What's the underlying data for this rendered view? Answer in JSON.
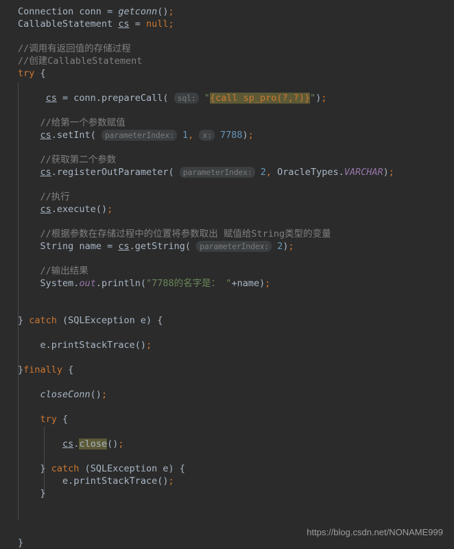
{
  "editor": {
    "theme": "darcula",
    "background": "#2B2B2B",
    "default_text_color": "#A9B7C6",
    "keyword_color": "#CC7832",
    "comment_color": "#808080",
    "number_color": "#6897BB",
    "string_color": "#6A8759",
    "static_field_color": "#9876AA",
    "hint_background": "#3B3F41",
    "hint_text_color": "#7A7A7A",
    "highlight_background": "#5C5A36",
    "indent_guide_color": "#4B4B4B"
  },
  "code": {
    "language": "Java",
    "lines": [
      "Connection conn = getconn();",
      "CallableStatement cs = null;",
      "",
      "//调用有返回值的存储过程",
      "//创建CallableStatement",
      "try {",
      "",
      "    cs = conn.prepareCall( sql: \"{call sp_pro(?,?)}\");",
      "",
      "    //给第一个参数赋值",
      "    cs.setInt( parameterIndex: 1, x: 7788);",
      "",
      "    //获取第二个参数",
      "    cs.registerOutParameter( parameterIndex: 2, OracleTypes.VARCHAR);",
      "",
      "    //执行",
      "    cs.execute();",
      "",
      "    //根据参数在存储过程中的位置将参数取出 赋值给String类型的变量",
      "    String name = cs.getString( parameterIndex: 2);",
      "",
      "    //输出结果",
      "    System.out.println(\"7788的名字是： \"+name);",
      "",
      "",
      "} catch (SQLException e) {",
      "",
      "    e.printStackTrace();",
      "",
      "}finally {",
      "",
      "    closeConn();",
      "",
      "    try {",
      "",
      "        cs.close();",
      "",
      "    } catch (SQLException e) {",
      "        e.printStackTrace();",
      "    }",
      "",
      "",
      "",
      "}"
    ]
  },
  "tokens": {
    "type_connection": "Connection",
    "var_conn": "conn",
    "assign": " = ",
    "method_getconn": "getconn",
    "type_callablestatement": "CallableStatement",
    "field_cs": "cs",
    "kw_null": "null",
    "kw_try": "try",
    "kw_catch": "catch",
    "kw_finally": "finally",
    "type_sqlexception": "SQLException",
    "var_e": "e",
    "type_string": "String",
    "var_name": "name",
    "type_system": "System",
    "field_out": "out",
    "method_println": "println",
    "method_preparecall": "prepareCall",
    "method_setint": "setInt",
    "method_registeroutparameter": "registerOutParameter",
    "method_execute": "execute",
    "method_getstring": "getString",
    "method_printstacktrace": "printStackTrace",
    "method_closeconn": "closeConn",
    "method_close": "close",
    "type_oracletypes": "OracleTypes",
    "field_varchar": "VARCHAR",
    "sql_literal": "{call sp_pro(?,?)}",
    "println_literal": "7788的名字是： ",
    "num_1": "1",
    "num_2": "2",
    "num_7788": "7788"
  },
  "hints": {
    "sql": "sql:",
    "parameter_index": "parameterIndex:",
    "x": "x:"
  },
  "comments": {
    "c1": "//调用有返回值的存储过程",
    "c2": "//创建CallableStatement",
    "c3": "//给第一个参数赋值",
    "c4": "//获取第二个参数",
    "c5": "//执行",
    "c6": "//根据参数在存储过程中的位置将参数取出 赋值给String类型的变量",
    "c7": "//输出结果"
  },
  "watermark": {
    "url": "https://blog.csdn.net/NONAME999"
  }
}
